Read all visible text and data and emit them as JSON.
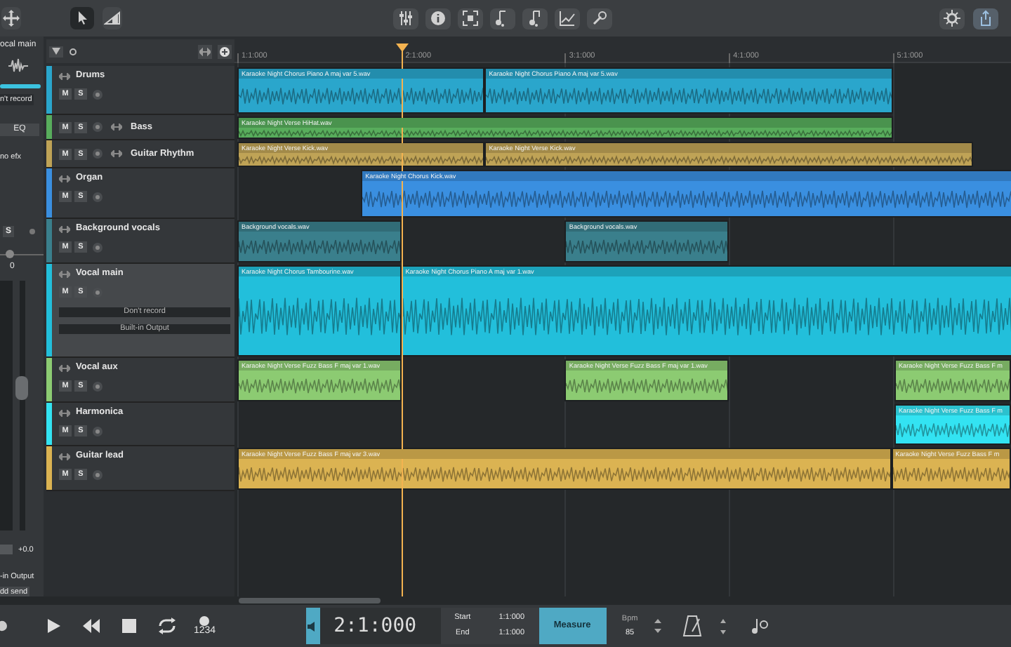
{
  "toolbar": {
    "tools": [
      {
        "selected": false
      },
      {
        "selected": true
      },
      {
        "selected": false
      }
    ]
  },
  "mixer_strip": {
    "title": "ocal main",
    "record": "n't record",
    "eq": "EQ",
    "fx": "no efx",
    "solo": "S",
    "pan": "0",
    "volume": "+0.0",
    "output": "-in Output",
    "send": "dd send"
  },
  "tracks": [
    {
      "name": "Drums",
      "kind": "full",
      "color": "#2aa6cc",
      "selected": false,
      "mute": "M",
      "solo": "S",
      "clips": [
        "Karaoke Night Chorus Piano A maj var 5.wav",
        "Karaoke Night Chorus Piano A maj var 5.wav"
      ]
    },
    {
      "name": "Bass",
      "kind": "compact",
      "color": "#58ad5c",
      "selected": false,
      "mute": "M",
      "solo": "S",
      "clips": [
        "Karaoke Night Verse HiHat.wav"
      ]
    },
    {
      "name": "Guitar Rhythm",
      "kind": "compact",
      "color": "#bfa356",
      "selected": false,
      "mute": "M",
      "solo": "S",
      "clips": [
        "Karaoke Night Verse Kick.wav",
        "Karaoke Night Verse Kick.wav"
      ]
    },
    {
      "name": "Organ",
      "kind": "full",
      "color": "#3a8fe0",
      "selected": false,
      "mute": "M",
      "solo": "S",
      "clips": [
        "Karaoke Night Chorus Kick.wav"
      ]
    },
    {
      "name": "Background vocals",
      "kind": "full",
      "color": "#3a7f8c",
      "selected": false,
      "mute": "M",
      "solo": "S",
      "clips": [
        "Background vocals.wav",
        "Background vocals.wav"
      ]
    },
    {
      "name": "Vocal main",
      "kind": "full",
      "color": "#22bfdb",
      "selected": true,
      "mute": "M",
      "solo": "S",
      "record": "Don't record",
      "output": "Built-in Output",
      "clips": [
        "Karaoke Night Chorus Tambourine.wav",
        "Karaoke Night Chorus Piano A maj var 1.wav"
      ]
    },
    {
      "name": "Vocal aux",
      "kind": "full",
      "color": "#8ccb72",
      "selected": false,
      "mute": "M",
      "solo": "S",
      "clips": [
        "Karaoke Night Verse Fuzz Bass F maj var 1.wav",
        "Karaoke Night Verse Fuzz Bass F maj var 1.wav",
        "Karaoke Night Verse Fuzz Bass F m"
      ]
    },
    {
      "name": "Harmonica",
      "kind": "full",
      "color": "#33e3f2",
      "selected": false,
      "mute": "M",
      "solo": "S",
      "clips": [
        "Karaoke Night Verse Fuzz Bass F m"
      ]
    },
    {
      "name": "Guitar lead",
      "kind": "full",
      "color": "#dbb352",
      "selected": false,
      "mute": "M",
      "solo": "S",
      "clips": [
        "Karaoke Night Verse Fuzz Bass F maj var 3.wav",
        "Karaoke Night Verse Fuzz Bass F m"
      ]
    }
  ],
  "ruler": [
    "1:1:000",
    "2:1:000",
    "3:1:000",
    "4:1:000",
    "5:1:000"
  ],
  "transport": {
    "count_in": "1234",
    "time": "2:1:000",
    "start_label": "Start",
    "start": "1:1:000",
    "end_label": "End",
    "end": "1:1:000",
    "mode": "Measure",
    "bpm_label": "Bpm",
    "bpm": "85"
  }
}
